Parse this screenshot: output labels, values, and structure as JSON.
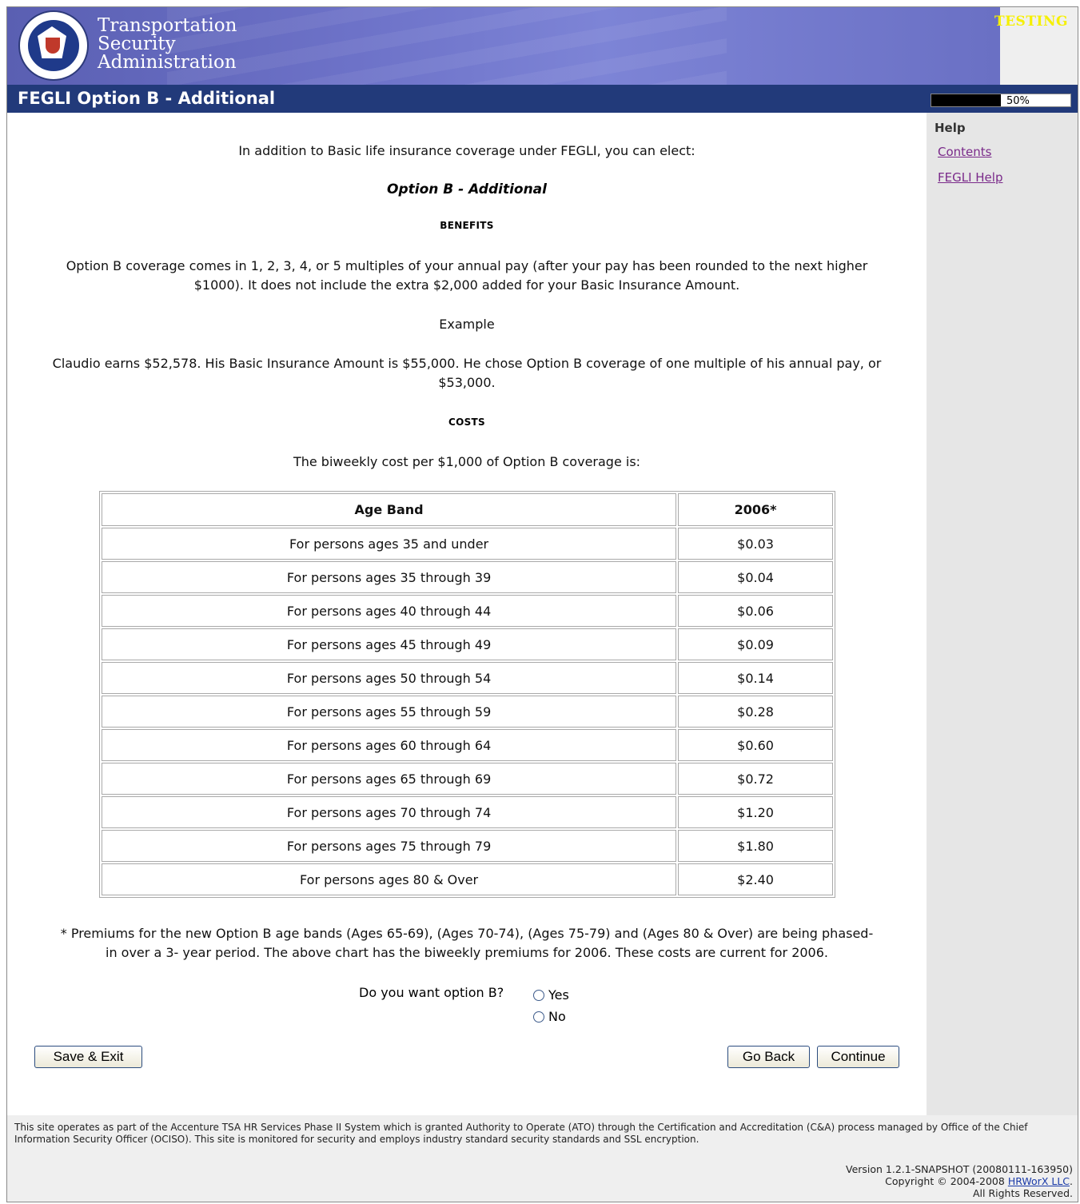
{
  "header": {
    "agency_line1": "Transportation",
    "agency_line2": "Security",
    "agency_line3": "Administration",
    "env_badge": "TESTING"
  },
  "titlebar": {
    "title": "FEGLI Option B - Additional",
    "progress_percent": 50,
    "progress_label": "50%"
  },
  "help": {
    "title": "Help",
    "links": [
      "Contents",
      "FEGLI Help"
    ]
  },
  "main": {
    "intro": "In addition to Basic life insurance coverage under FEGLI, you can elect:",
    "option_heading": "Option B - Additional",
    "benefits_heading": "BENEFITS",
    "benefits_line1": "Option B coverage comes in 1, 2, 3, 4, or 5 multiples of your annual pay (after your pay has been rounded to the next higher",
    "benefits_line2": "$1000). It does not include the extra $2,000 added for your Basic Insurance Amount.",
    "example_heading": "Example",
    "example_line1": "Claudio earns $52,578. His Basic Insurance Amount is $55,000. He chose Option B coverage of one multiple of his annual pay, or",
    "example_line2": "$53,000.",
    "costs_heading": "COSTS",
    "costs_intro": "The biweekly cost per $1,000 of Option B coverage is:",
    "table": {
      "headers": [
        "Age Band",
        "2006*"
      ],
      "rows": [
        [
          "For persons ages 35 and under",
          "$0.03"
        ],
        [
          "For persons ages 35 through 39",
          "$0.04"
        ],
        [
          "For persons ages 40 through 44",
          "$0.06"
        ],
        [
          "For persons ages 45 through 49",
          "$0.09"
        ],
        [
          "For persons ages 50 through 54",
          "$0.14"
        ],
        [
          "For persons ages 55 through 59",
          "$0.28"
        ],
        [
          "For persons ages 60 through 64",
          "$0.60"
        ],
        [
          "For persons ages 65 through 69",
          "$0.72"
        ],
        [
          "For persons ages 70 through 74",
          "$1.20"
        ],
        [
          "For persons ages 75 through 79",
          "$1.80"
        ],
        [
          "For persons ages 80 & Over",
          "$2.40"
        ]
      ]
    },
    "footnote_line1": "* Premiums for the new Option B age bands (Ages 65-69), (Ages 70-74), (Ages 75-79) and (Ages 80 & Over) are being phased-",
    "footnote_line2": "in over a 3- year period. The above chart has the biweekly premiums for 2006. These costs are current for 2006.",
    "question": "Do you want option B?",
    "options": [
      "Yes",
      "No"
    ],
    "buttons": {
      "save_exit": "Save & Exit",
      "go_back": "Go Back",
      "continue": "Continue"
    }
  },
  "footer": {
    "note": "This site operates as part of the Accenture TSA HR Services Phase II System which is granted Authority to Operate (ATO) through the Certification and Accreditation (C&A) process managed by Office of the Chief Information Security Officer (OCISO). This site is monitored for security and employs industry standard security standards and SSL encryption.",
    "version": "Version 1.2.1-SNAPSHOT (20080111-163950)",
    "copyright_prefix": "Copyright © 2004-2008",
    "copyright_link": "HRWorX LLC",
    "copyright_suffix": ".",
    "rights": "All Rights Reserved."
  }
}
